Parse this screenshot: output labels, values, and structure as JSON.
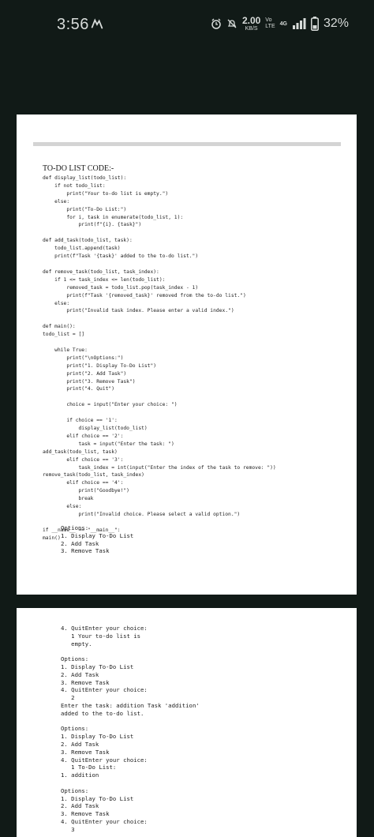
{
  "status_bar": {
    "time": "3:56",
    "net_speed_value": "2.00",
    "net_speed_unit": "KB/S",
    "volte_top": "Vo",
    "volte_bottom": "LTE",
    "network_type": "4G",
    "battery_percent": "32%",
    "icons": [
      "notification-icon",
      "alarm-icon",
      "mute-icon",
      "signal-icon",
      "battery-icon"
    ]
  },
  "document": {
    "heading": "TO-DO LIST CODE:-",
    "code": [
      "def display_list(todo_list):",
      "    if not todo_list:",
      "        print(\"Your to-do list is empty.\")",
      "    else:",
      "        print(\"To-Do List:\")",
      "        for i, task in enumerate(todo_list, 1):",
      "            print(f\"{i}. {task}\")",
      "",
      "def add_task(todo_list, task):",
      "    todo_list.append(task)",
      "    print(f\"Task '{task}' added to the to-do list.\")",
      "",
      "def remove_task(todo_list, task_index):",
      "    if 1 <= task_index <= len(todo_list):",
      "        removed_task = todo_list.pop(task_index - 1)",
      "        print(f\"Task '{removed_task}' removed from the to-do list.\")",
      "    else:",
      "        print(\"Invalid task index. Please enter a valid index.\")",
      "",
      "def main():",
      "todo_list = []",
      "",
      "    while True:",
      "        print(\"\\nOptions:\")",
      "        print(\"1. Display To-Do List\")",
      "        print(\"2. Add Task\")",
      "        print(\"3. Remove Task\")",
      "        print(\"4. Quit\")",
      "",
      "        choice = input(\"Enter your choice: \")",
      "",
      "        if choice == '1':",
      "            display_list(todo_list)",
      "        elif choice == '2':",
      "            task = input(\"Enter the task: \")",
      "add_task(todo_list, task)",
      "        elif choice == '3':",
      "            task_index = int(input(\"Enter the index of the task to remove: \"))",
      "remove_task(todo_list, task_index)",
      "        elif choice == '4':",
      "            print(\"Goodbye!\")",
      "            break",
      "        else:",
      "            print(\"Invalid choice. Please select a valid option.\")",
      "",
      "if __name__ == \"__main__\":",
      "main()"
    ],
    "output_page1": [
      "Options:",
      "1. Display To-Do List",
      "2. Add Task",
      "3. Remove Task"
    ],
    "output_page2": [
      "4. QuitEnter your choice:",
      "   1 Your to-do list is",
      "   empty.",
      "",
      "Options:",
      "1. Display To-Do List",
      "2. Add Task",
      "3. Remove Task",
      "4. QuitEnter your choice:",
      "   2",
      "Enter the task: addition Task 'addition'",
      "added to the to-do list.",
      "",
      "Options:",
      "1. Display To-Do List",
      "2. Add Task",
      "3. Remove Task",
      "4. QuitEnter your choice:",
      "   1 To-Do List:",
      "1. addition",
      "",
      "Options:",
      "1. Display To-Do List",
      "2. Add Task",
      "3. Remove Task",
      "4. QuitEnter your choice:",
      "   3"
    ]
  }
}
